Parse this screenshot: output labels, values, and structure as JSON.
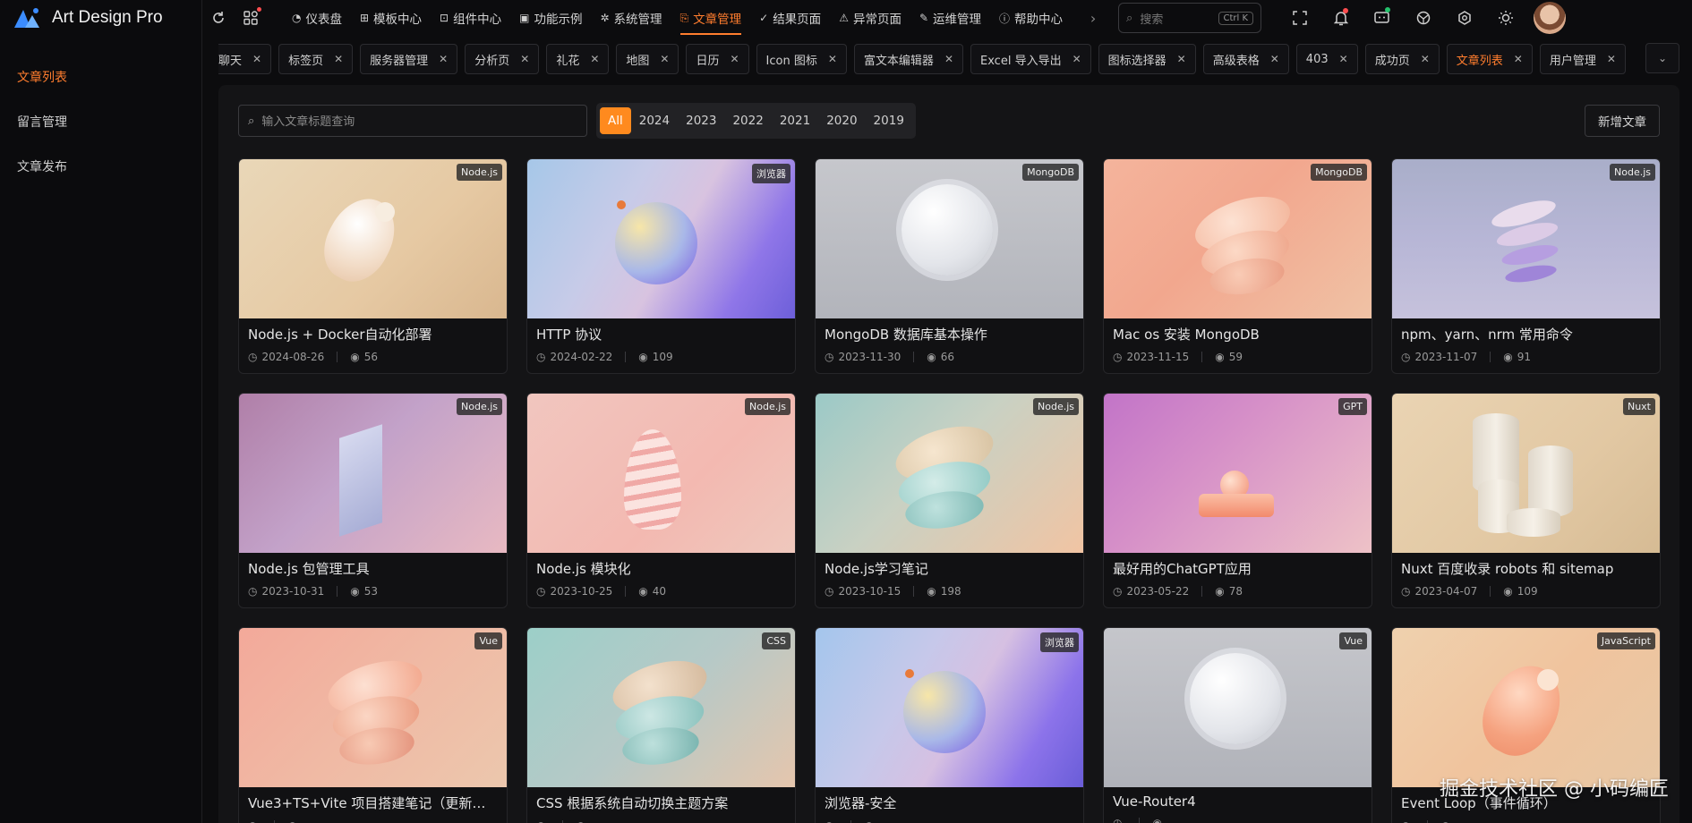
{
  "app": {
    "name": "Art Design Pro"
  },
  "sidebar": {
    "items": [
      {
        "label": "文章列表",
        "active": true
      },
      {
        "label": "留言管理",
        "active": false
      },
      {
        "label": "文章发布",
        "active": false
      }
    ]
  },
  "topnav": {
    "items": [
      {
        "label": "仪表盘",
        "icon": "dashboard-icon"
      },
      {
        "label": "模板中心",
        "icon": "template-icon"
      },
      {
        "label": "组件中心",
        "icon": "component-icon"
      },
      {
        "label": "功能示例",
        "icon": "example-icon"
      },
      {
        "label": "系统管理",
        "icon": "settings-icon"
      },
      {
        "label": "文章管理",
        "icon": "article-icon",
        "active": true
      },
      {
        "label": "结果页面",
        "icon": "result-icon"
      },
      {
        "label": "异常页面",
        "icon": "exception-icon"
      },
      {
        "label": "运维管理",
        "icon": "ops-icon"
      },
      {
        "label": "帮助中心",
        "icon": "help-icon"
      }
    ]
  },
  "search": {
    "placeholder": "搜索",
    "shortcut": "Ctrl K"
  },
  "tabs": [
    {
      "label": "聊天"
    },
    {
      "label": "标签页"
    },
    {
      "label": "服务器管理"
    },
    {
      "label": "分析页"
    },
    {
      "label": "礼花"
    },
    {
      "label": "地图"
    },
    {
      "label": "日历"
    },
    {
      "label": "Icon 图标"
    },
    {
      "label": "富文本编辑器"
    },
    {
      "label": "Excel 导入导出"
    },
    {
      "label": "图标选择器"
    },
    {
      "label": "高级表格"
    },
    {
      "label": "403"
    },
    {
      "label": "成功页"
    },
    {
      "label": "文章列表",
      "active": true
    },
    {
      "label": "用户管理"
    }
  ],
  "toolbar": {
    "search_placeholder": "输入文章标题查询",
    "years": [
      "All",
      "2024",
      "2023",
      "2022",
      "2021",
      "2020",
      "2019"
    ],
    "active_year": "All",
    "add_label": "新增文章"
  },
  "articles": [
    {
      "tag": "Node.js",
      "title": "Node.js + Docker自动化部署",
      "date": "2024-08-26",
      "views": "56"
    },
    {
      "tag": "浏览器",
      "title": "HTTP 协议",
      "date": "2024-02-22",
      "views": "109"
    },
    {
      "tag": "MongoDB",
      "title": "MongoDB 数据库基本操作",
      "date": "2023-11-30",
      "views": "66"
    },
    {
      "tag": "MongoDB",
      "title": "Mac os 安装 MongoDB",
      "date": "2023-11-15",
      "views": "59"
    },
    {
      "tag": "Node.js",
      "title": "npm、yarn、nrm 常用命令",
      "date": "2023-11-07",
      "views": "91"
    },
    {
      "tag": "Node.js",
      "title": "Node.js 包管理工具",
      "date": "2023-10-31",
      "views": "53"
    },
    {
      "tag": "Node.js",
      "title": "Node.js 模块化",
      "date": "2023-10-25",
      "views": "40"
    },
    {
      "tag": "Node.js",
      "title": "Node.js学习笔记",
      "date": "2023-10-15",
      "views": "198"
    },
    {
      "tag": "GPT",
      "title": "最好用的ChatGPT应用",
      "date": "2023-05-22",
      "views": "78"
    },
    {
      "tag": "Nuxt",
      "title": "Nuxt 百度收录 robots 和 sitemap",
      "date": "2023-04-07",
      "views": "109"
    },
    {
      "tag": "Vue",
      "title": "Vue3+TS+Vite 项目搭建笔记（更新…",
      "date": "",
      "views": ""
    },
    {
      "tag": "CSS",
      "title": "CSS 根据系统自动切换主题方案",
      "date": "",
      "views": ""
    },
    {
      "tag": "浏览器",
      "title": "浏览器-安全",
      "date": "",
      "views": ""
    },
    {
      "tag": "Vue",
      "title": "Vue-Router4",
      "date": "",
      "views": ""
    },
    {
      "tag": "JavaScript",
      "title": "Event Loop（事件循环）",
      "date": "",
      "views": ""
    }
  ],
  "watermark": "掘金技术社区 @ 小码编匠",
  "colors": {
    "accent": "#ff7d2e",
    "year_active": "#ff8a1e",
    "background": "#0c0c0e",
    "panel": "#141416"
  }
}
